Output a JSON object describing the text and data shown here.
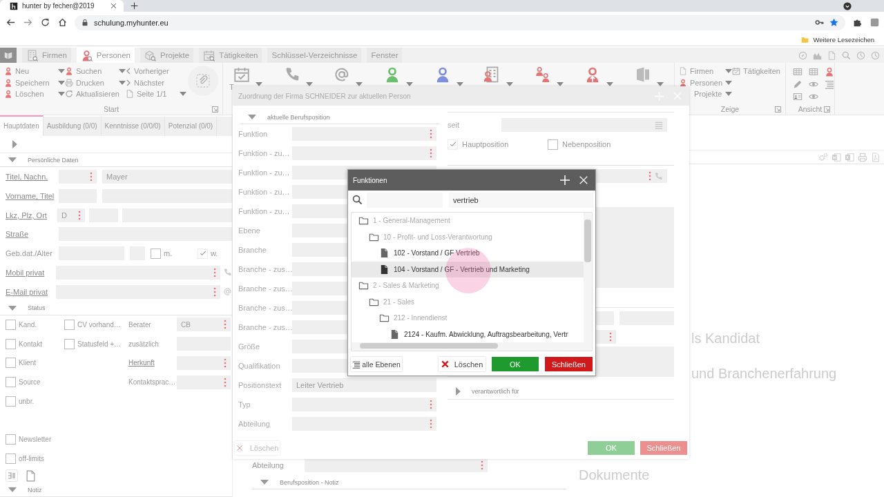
{
  "browser": {
    "tab_title": "hunter by fecher@2019",
    "url": "schulung.myhunter.eu",
    "bookmark": "Weitere Lesezeichen"
  },
  "menu": [
    {
      "label": "Firmen",
      "selected": false
    },
    {
      "label": "Personen",
      "selected": true
    },
    {
      "label": "Projekte",
      "selected": false
    },
    {
      "label": "Tätigkeiten",
      "selected": false
    },
    {
      "label": "Schlüssel-Verzeichnisse",
      "selected": false
    },
    {
      "label": "Fenster",
      "selected": false
    }
  ],
  "ribbon": {
    "start": {
      "columns": [
        [
          {
            "label": "Neu",
            "dropdown": true
          },
          {
            "label": "Speichern",
            "dropdown": true
          },
          {
            "label": "Löschen",
            "dropdown": true
          }
        ],
        [
          {
            "label": "Suchen",
            "dropdown": true
          },
          {
            "label": "Drucken",
            "dropdown": true
          },
          {
            "label": "Aktualisieren",
            "dropdown": false
          }
        ],
        [
          {
            "label": "Vorheriger",
            "dropdown": false
          },
          {
            "label": "Nächster",
            "dropdown": false
          },
          {
            "label": "Seite 1/1",
            "dropdown": true
          }
        ]
      ],
      "group_label": "Start"
    },
    "large_button_label": "T",
    "zeige": {
      "items": [
        {
          "label": "Firmen",
          "dropdown": true
        },
        {
          "label": "Personen",
          "dropdown": true
        },
        {
          "label": "Projekte",
          "dropdown": true
        },
        {
          "label": "Tätigkeiten",
          "dropdown": false
        }
      ],
      "group_label": "Zeige"
    },
    "ansicht": {
      "group_label": "Ansicht"
    }
  },
  "person": {
    "tabs": [
      {
        "label": "Hauptdaten",
        "selected": true
      },
      {
        "label": "Ausbildung (0/0)",
        "selected": false
      },
      {
        "label": "Kenntnisse (0/0/0)",
        "selected": false
      },
      {
        "label": "Potenzial (0/0)",
        "selected": false
      }
    ],
    "section_personal": "Persönliche Daten",
    "rows": [
      {
        "kind": "pair",
        "label": "Titel, Nachn.",
        "link": true,
        "fields": [
          {
            "menu": true
          },
          {
            "value": "Mayer",
            "menu": false
          }
        ]
      },
      {
        "kind": "pair",
        "label": "Vorname, Titel",
        "link": true,
        "fields": [
          {
            "menu": false
          },
          {
            "menu": false
          }
        ]
      },
      {
        "kind": "triple",
        "label": "Lkz, Plz, Ort",
        "link": true,
        "fields": [
          {
            "value": "D",
            "menu": true
          },
          {
            "menu": false
          },
          {
            "menu": false
          }
        ]
      },
      {
        "kind": "single",
        "label": "Straße",
        "link": true,
        "fields": [
          {
            "menu": false
          }
        ]
      },
      {
        "kind": "birth",
        "label": "Geb.dat./Alter",
        "link": false,
        "fields": [
          {
            "menu": false
          },
          {
            "menu": false
          }
        ],
        "options": [
          {
            "label": "m.",
            "checked": false
          },
          {
            "label": "w.",
            "checked": true
          }
        ]
      },
      {
        "kind": "phone",
        "label": "Mobil privat",
        "link": true,
        "fields": [
          {
            "menu": true
          }
        ]
      },
      {
        "kind": "email",
        "label": "E-Mail privat",
        "link": true,
        "fields": [
          {
            "menu": true
          }
        ]
      }
    ],
    "section_status": "Status",
    "status_rows": [
      {
        "checks": [
          {
            "label": "Kand.",
            "checked": false
          },
          {
            "label": "CV vorhand…",
            "checked": false
          }
        ],
        "label": "Berater",
        "link": false,
        "field": {
          "value": "CB",
          "menu": true
        }
      },
      {
        "checks": [
          {
            "label": "Kontakt",
            "checked": false
          },
          {
            "label": "Statusfeld +…",
            "checked": false
          }
        ],
        "label": "zusätzlich",
        "link": false,
        "field": {
          "menu": false
        }
      },
      {
        "checks": [
          {
            "label": "Klient",
            "checked": false
          }
        ],
        "label": "Herkunft",
        "link": true,
        "field": {
          "menu": true
        }
      },
      {
        "checks": [
          {
            "label": "Source",
            "checked": false
          }
        ],
        "label": "Kontaktsprac…",
        "link": false,
        "field": {
          "menu": true
        }
      },
      {
        "checks": [
          {
            "label": "unbr.",
            "checked": false
          }
        ]
      }
    ],
    "extra_checks": [
      {
        "label": "Newsletter",
        "checked": false
      },
      {
        "label": "off-limits",
        "checked": false
      }
    ],
    "section_note": "Notiz"
  },
  "background": {
    "headings": [
      "ls Kandidat",
      "und Branchenerfahrung"
    ],
    "lower_field": {
      "label": "Abteilung",
      "menu": true
    },
    "note_section": "Berufsposition - Notiz",
    "documents_heading": "Dokumente"
  },
  "assignment_dialog": {
    "title": "Zuordnung der Firma SCHNEIDER zur aktuellen Person",
    "section": "aktuelle Berufsposition",
    "fields": [
      {
        "label": "Funktion",
        "menu": true
      },
      {
        "label": "Funktion - zu…",
        "menu": true
      },
      {
        "label": "Funktion - zu…",
        "menu": false
      },
      {
        "label": "Funktion - zu…",
        "menu": false
      },
      {
        "label": "Funktion - zu…",
        "menu": false
      },
      {
        "label": "Ebene",
        "menu": false
      },
      {
        "label": "Branche",
        "menu": false
      },
      {
        "label": "Branche - zus…",
        "menu": false
      },
      {
        "label": "Branche - zus…",
        "menu": false
      },
      {
        "label": "Branche - zus…",
        "menu": false
      },
      {
        "label": "Branche - zus…",
        "menu": false
      },
      {
        "label": "Größe",
        "menu": false
      },
      {
        "label": "Qualifikation",
        "menu": false
      },
      {
        "label": "Positionstext",
        "value": "Leiter Vertrieb",
        "menu": false
      },
      {
        "label": "Typ",
        "menu": true
      },
      {
        "label": "Abteilung",
        "menu": true
      }
    ],
    "since_label": "seit",
    "position_options": [
      {
        "label": "Hauptposition",
        "checked": true
      },
      {
        "label": "Nebenposition",
        "checked": false
      }
    ],
    "responsible_section": "verantwortlich für",
    "delete_button": "Löschen",
    "ok_button": "OK",
    "close_button": "Schließen"
  },
  "functions_dialog": {
    "title": "Funktionen",
    "search_value": "vertrieb",
    "tree": [
      {
        "kind": "folder",
        "label": "1 - General-Management",
        "selected": false,
        "children": [
          {
            "kind": "folder",
            "label": "10 - Profit- und Loss-Verantwortung",
            "selected": false,
            "children": [
              {
                "kind": "document",
                "label": "102 - Vorstand / GF Vertrieb",
                "selected": false
              },
              {
                "kind": "document",
                "label": "104 - Vorstand / GF - Vertrieb und Marketing",
                "selected": true
              }
            ]
          }
        ]
      },
      {
        "kind": "folder",
        "label": "2 - Sales & Marketing",
        "selected": false,
        "children": [
          {
            "kind": "folder",
            "label": "21 - Sales",
            "selected": false,
            "children": [
              {
                "kind": "folder",
                "label": "212 - Innendienst",
                "selected": false,
                "children": [
                  {
                    "kind": "document",
                    "label": "2124 - Kaufm. Abwicklung, Auftragsbearbeitung, Vertr",
                    "selected": false
                  }
                ]
              }
            ]
          }
        ]
      }
    ],
    "buttons": [
      {
        "kind": "levels",
        "label": "alle Ebenen"
      },
      {
        "kind": "delete",
        "label": "Löschen"
      },
      {
        "kind": "ok",
        "label": "OK"
      },
      {
        "kind": "close",
        "label": "Schließen"
      }
    ]
  }
}
